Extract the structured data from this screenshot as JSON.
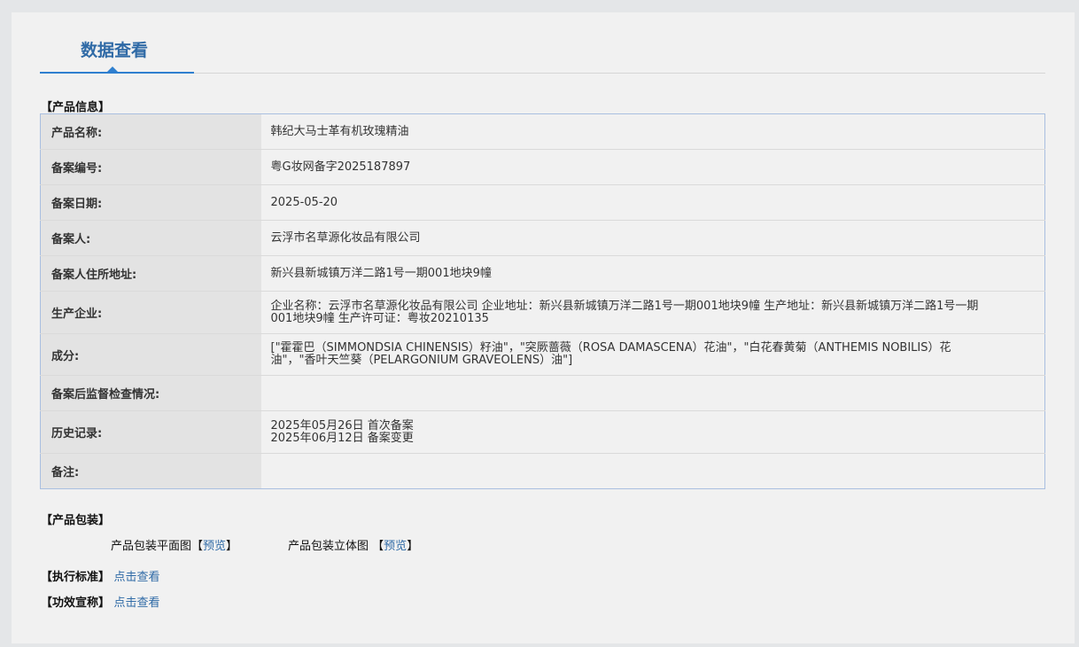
{
  "header": {
    "title": "数据查看"
  },
  "product_info": {
    "section_title": "【产品信息】",
    "rows": [
      {
        "label": "产品名称:",
        "lines": [
          "韩纪大马士革有机玫瑰精油"
        ]
      },
      {
        "label": "备案编号:",
        "lines": [
          "粤G妆网备字2025187897"
        ]
      },
      {
        "label": "备案日期:",
        "lines": [
          "2025-05-20"
        ]
      },
      {
        "label": "备案人:",
        "lines": [
          "云浮市名草源化妆品有限公司"
        ]
      },
      {
        "label": "备案人住所地址:",
        "lines": [
          "新兴县新城镇万洋二路1号一期001地块9幢"
        ]
      },
      {
        "label": "生产企业:",
        "lines": [
          "企业名称：云浮市名草源化妆品有限公司 企业地址：新兴县新城镇万洋二路1号一期001地块9幢 生产地址：新兴县新城镇万洋二路1号一期001地块9幢 生产许可证：粤妆20210135"
        ]
      },
      {
        "label": "成分:",
        "lines": [
          "[\"霍霍巴（SIMMONDSIA CHINENSIS）籽油\"，\"突厥蔷薇（ROSA DAMASCENA）花油\"，\"白花春黄菊（ANTHEMIS NOBILIS）花油\"，\"香叶天竺葵（PELARGONIUM GRAVEOLENS）油\"]"
        ]
      },
      {
        "label": "备案后监督检查情况:",
        "lines": [
          ""
        ]
      },
      {
        "label": "历史记录:",
        "lines": [
          "2025年05月26日 首次备案",
          "2025年06月12日 备案变更"
        ]
      },
      {
        "label": "备注:",
        "lines": [
          ""
        ]
      }
    ]
  },
  "packaging": {
    "section_title": "【产品包装】",
    "flat_label": "产品包装平面图",
    "solid_label": "产品包装立体图",
    "bracket_open": "【",
    "bracket_close": "】",
    "preview_label": "预览"
  },
  "standard": {
    "section_title": "【执行标准】",
    "link_label": "点击查看"
  },
  "efficacy": {
    "section_title": "【功效宣称】",
    "link_label": "点击查看"
  }
}
